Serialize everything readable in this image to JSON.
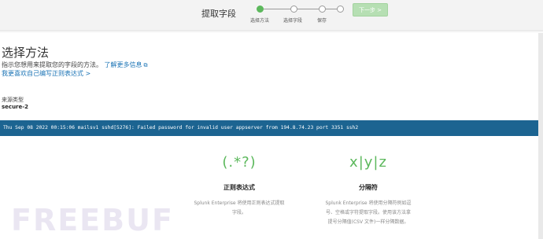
{
  "header": {
    "title": "提取字段",
    "steps": [
      {
        "label": "选择方法",
        "state": "active"
      },
      {
        "label": "选择字段",
        "state": "pending"
      },
      {
        "label": "保存",
        "state": "pending"
      }
    ],
    "next_label": "下一步 >"
  },
  "main": {
    "section_title": "选择方法",
    "description": "指示您想用来提取您的字段的方法。",
    "learn_more": "了解更多信息",
    "regex_link": "我更喜欢自己编写正则表达式 >",
    "source_type_label": "来源类型",
    "source_type_value": "secure-2",
    "sample_event": "Thu Sep 08 2022 00:15:06 mailsv1 sshd[5276]: Failed password for invalid user appserver from 194.8.74.23 port 3351 ssh2"
  },
  "methods": [
    {
      "icon_text": "(.*?)",
      "icon": "regex-icon",
      "title": "正则表达式",
      "desc_line1": "Splunk Enterprise 将使用正则表达式提取",
      "desc_line2": "字段。"
    },
    {
      "icon_text": "x|y|z",
      "icon": "delimiter-icon",
      "title": "分隔符",
      "desc_line1": "Splunk Enterprise 将使用分隔符例如逗",
      "desc_line2": "号、空格或字符提取字段。使用该方法拿",
      "desc_line3": "提号分隔值(CSV 文件)一样分隔数据。"
    }
  ],
  "watermark": "FREEBUF",
  "colors": {
    "accent_green": "#5cb85c",
    "event_bar": "#1c6491",
    "link_blue": "#1a73b5"
  }
}
